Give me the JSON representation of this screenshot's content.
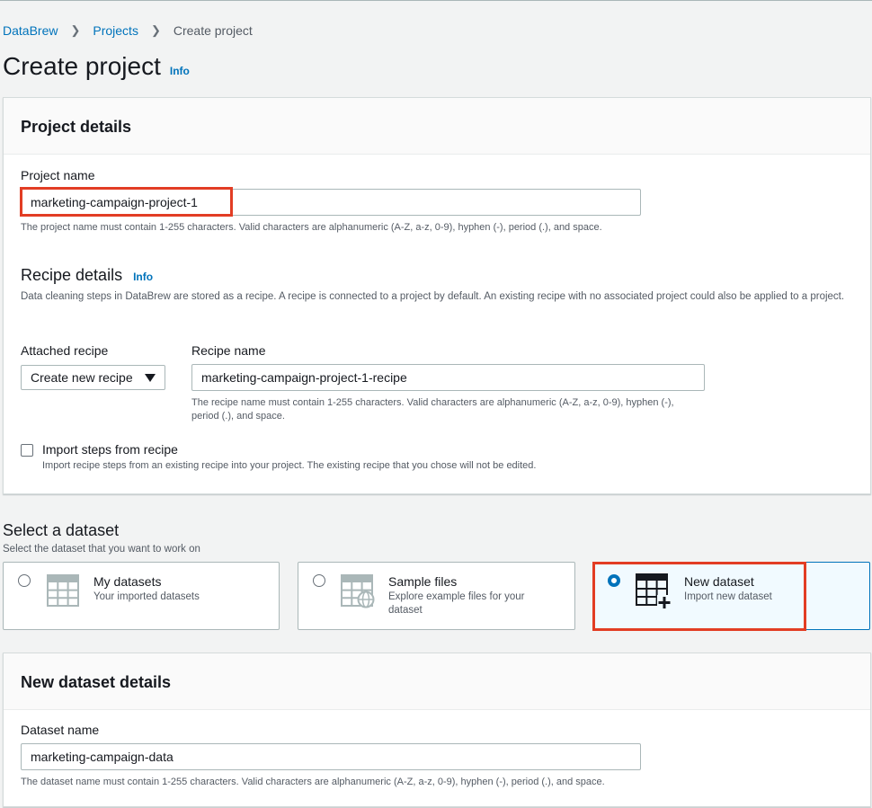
{
  "breadcrumb": {
    "items": [
      "DataBrew",
      "Projects",
      "Create project"
    ]
  },
  "page": {
    "title": "Create project",
    "info_label": "Info"
  },
  "project_details": {
    "heading": "Project details",
    "name_label": "Project name",
    "name_value": "marketing-campaign-project-1",
    "name_hint": "The project name must contain 1-255 characters. Valid characters are alphanumeric (A-Z, a-z, 0-9), hyphen (-), period (.), and space."
  },
  "recipe_details": {
    "heading": "Recipe details",
    "info_label": "Info",
    "description": "Data cleaning steps in DataBrew are stored as a recipe. A recipe is connected to a project by default. An existing recipe with no associated project could also be applied to a project.",
    "attached_label": "Attached recipe",
    "attached_value": "Create new recipe",
    "recipe_name_label": "Recipe name",
    "recipe_name_value": "marketing-campaign-project-1-recipe",
    "recipe_name_hint": "The recipe name must contain 1-255 characters. Valid characters are alphanumeric (A-Z, a-z, 0-9), hyphen (-), period (.), and space.",
    "import_label": "Import steps from recipe",
    "import_desc": "Import recipe steps from an existing recipe into your project. The existing recipe that you chose will not be edited.",
    "import_checked": false
  },
  "dataset_select": {
    "heading": "Select a dataset",
    "subheading": "Select the dataset that you want to work on",
    "options": [
      {
        "title": "My datasets",
        "desc": "Your imported datasets",
        "selected": false,
        "icon": "table-grid-icon"
      },
      {
        "title": "Sample files",
        "desc": "Explore example files for your dataset",
        "selected": false,
        "icon": "table-globe-icon"
      },
      {
        "title": "New dataset",
        "desc": "Import new dataset",
        "selected": true,
        "icon": "table-plus-icon"
      }
    ]
  },
  "new_dataset": {
    "heading": "New dataset details",
    "name_label": "Dataset name",
    "name_value": "marketing-campaign-data",
    "name_hint": "The dataset name must contain 1-255 characters. Valid characters are alphanumeric (A-Z, a-z, 0-9), hyphen (-), period (.), and space."
  },
  "colors": {
    "link": "#0073bb",
    "highlight": "#e23d24",
    "selected_bg": "#f1faff"
  }
}
